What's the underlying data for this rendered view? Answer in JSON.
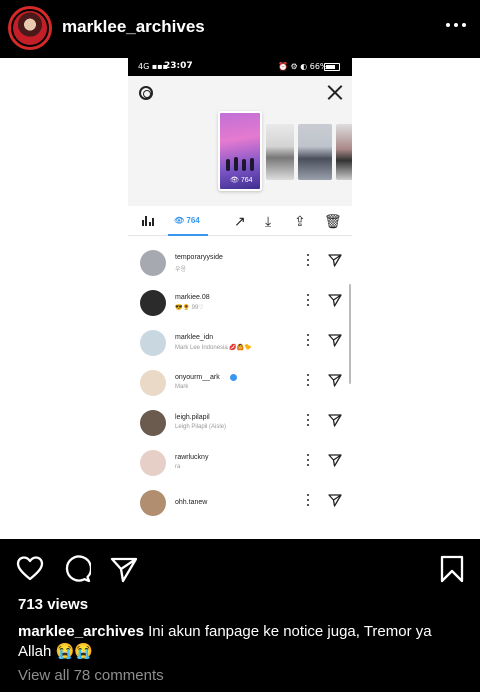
{
  "post": {
    "username": "marklee_archives",
    "views": "713 views",
    "caption_text": "Ini akun fanpage ke notice juga, Tremor ya Allah 😭😭",
    "comments_link": "View all 78 comments"
  },
  "phone": {
    "status_left": "4G ▪▪▪ ",
    "time": "23:07",
    "status_right": "⏰ ⚙ ◐ 66%",
    "story_views": "👁 764",
    "tab_viewers": "👁 764"
  },
  "viewers": [
    {
      "username": "temporaryyside",
      "subtitle": "우응",
      "verified": false,
      "color": "#a7a9b0"
    },
    {
      "username": "markiee.08",
      "subtitle": "😎🌻 99♡",
      "verified": false,
      "color": "#2b2b2b"
    },
    {
      "username": "marklee_idn",
      "subtitle": "Mark Lee Indonesia 💋🙆🐤",
      "verified": false,
      "color": "#c9d7e0"
    },
    {
      "username": "onyourm__ark",
      "subtitle": "Mark",
      "verified": true,
      "color": "#e9d9c6"
    },
    {
      "username": "leigh.pilapil",
      "subtitle": "Leigh Pilapil (Aisle)",
      "verified": false,
      "color": "#6b5a4e"
    },
    {
      "username": "rawrluckny",
      "subtitle": "ra",
      "verified": false,
      "color": "#e6cfc6"
    },
    {
      "username": "ohh.tanew",
      "subtitle": "",
      "verified": false,
      "color": "#b18e6f"
    }
  ],
  "icons": {
    "more": "more-options-icon",
    "like": "heart-icon",
    "comment": "comment-bubble-icon",
    "share": "paper-plane-icon",
    "save": "bookmark-icon"
  },
  "colors": {
    "background": "#000000",
    "accent_blue": "#3897f0",
    "muted_text": "#8e8e8e"
  }
}
